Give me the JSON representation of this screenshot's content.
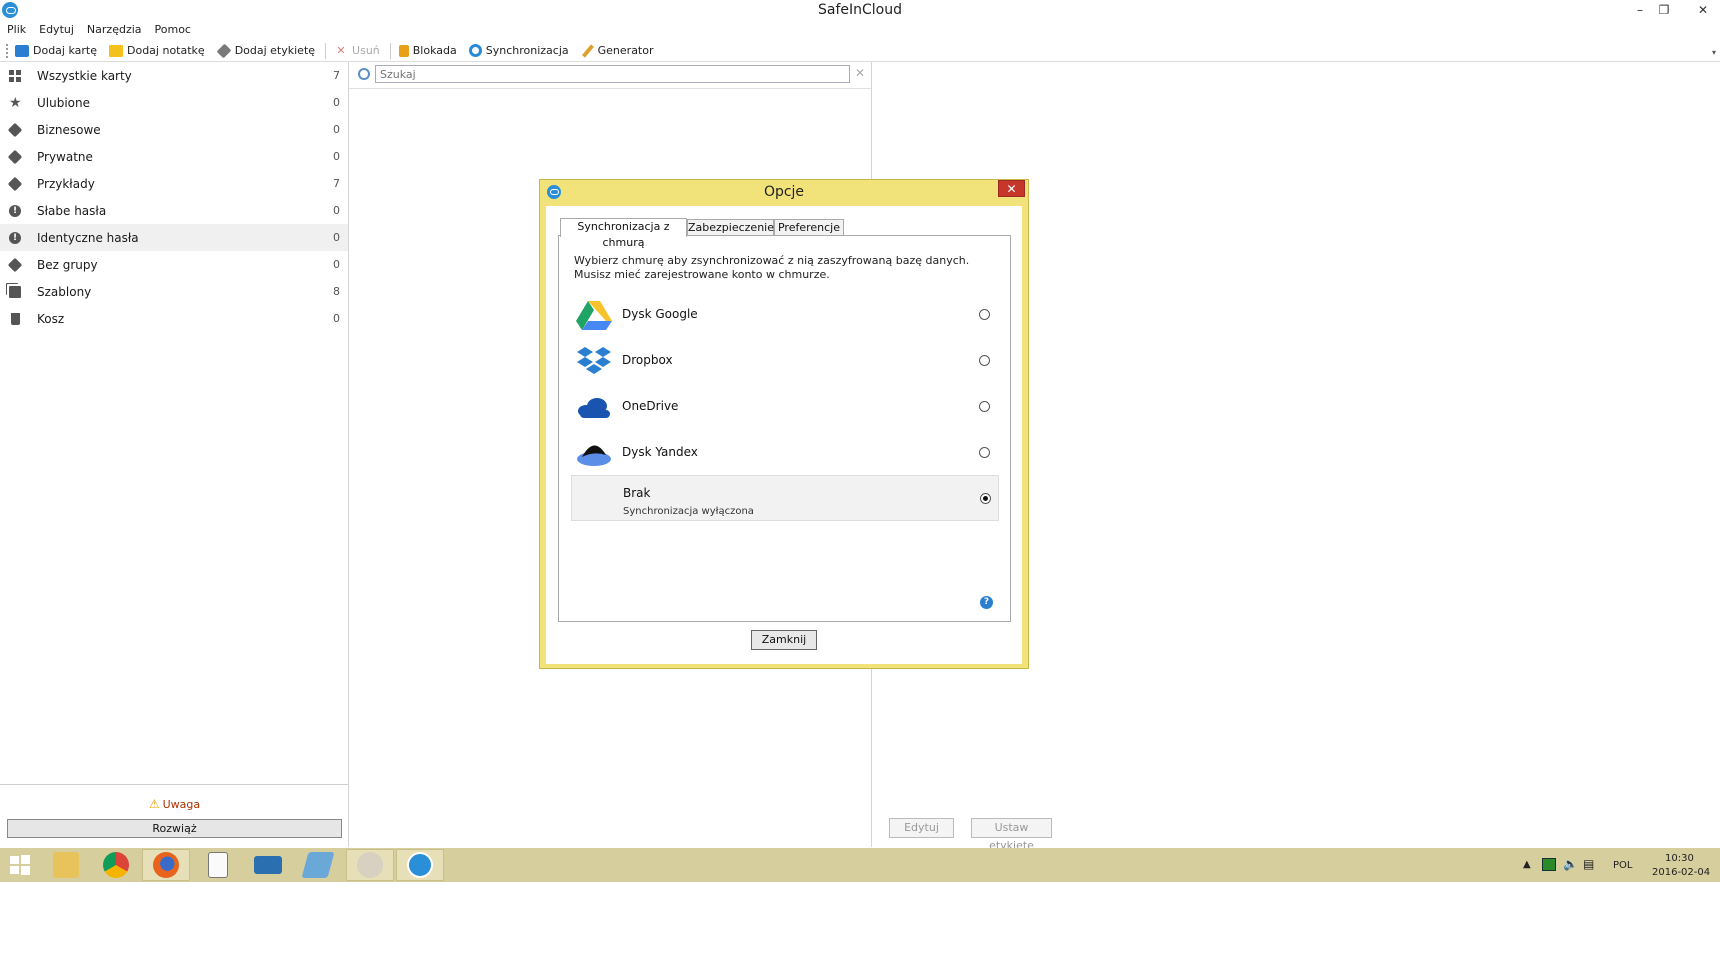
{
  "window": {
    "title": "SafeInCloud",
    "minimize": "–",
    "restore": "❐",
    "close": "✕"
  },
  "menu": [
    "Plik",
    "Edytuj",
    "Narzędzia",
    "Pomoc"
  ],
  "toolbar": {
    "add_card": "Dodaj kartę",
    "add_note": "Dodaj notatkę",
    "add_label": "Dodaj etykietę",
    "delete": "Usuń",
    "lock": "Blokada",
    "sync": "Synchronizacja",
    "generator": "Generator"
  },
  "sidebar": {
    "items": [
      {
        "label": "Wszystkie karty",
        "count": "7",
        "icon": "grid-icon"
      },
      {
        "label": "Ulubione",
        "count": "0",
        "icon": "star-icon"
      },
      {
        "label": "Biznesowe",
        "count": "0",
        "icon": "tag-icon"
      },
      {
        "label": "Prywatne",
        "count": "0",
        "icon": "tag-icon"
      },
      {
        "label": "Przykłady",
        "count": "7",
        "icon": "tag-icon"
      },
      {
        "label": "Słabe hasła",
        "count": "0",
        "icon": "warning-icon"
      },
      {
        "label": "Identyczne hasła",
        "count": "0",
        "icon": "warning-icon"
      },
      {
        "label": "Bez grupy",
        "count": "0",
        "icon": "untagged-icon"
      },
      {
        "label": "Szablony",
        "count": "8",
        "icon": "templates-icon"
      },
      {
        "label": "Kosz",
        "count": "0",
        "icon": "trash-icon"
      }
    ],
    "warning": "Uwaga",
    "solve_button": "Rozwiąż"
  },
  "search": {
    "placeholder": "Szukaj",
    "clear": "✕"
  },
  "details": {
    "edit_button": "Edytuj",
    "set_label_button": "Ustaw etykietę"
  },
  "dialog": {
    "title": "Opcje",
    "close_x": "✕",
    "tabs": [
      "Synchronizacja z chmurą",
      "Zabezpieczenie",
      "Preferencje"
    ],
    "intro": "Wybierz chmurę aby zsynchronizować z nią zaszyfrowaną bazę danych. Musisz mieć zarejestrowane konto w chmurze.",
    "clouds": [
      {
        "name": "Dysk Google",
        "sub": "",
        "checked": false
      },
      {
        "name": "Dropbox",
        "sub": "",
        "checked": false
      },
      {
        "name": "OneDrive",
        "sub": "",
        "checked": false
      },
      {
        "name": "Dysk Yandex",
        "sub": "",
        "checked": false
      },
      {
        "name": "Brak",
        "sub": "Synchronizacja wyłączona",
        "checked": true
      }
    ],
    "help": "?",
    "close_button": "Zamknij"
  },
  "taskbar": {
    "language": "POL",
    "time": "10:30",
    "date": "2016-02-04",
    "tray_arrow": "▲"
  },
  "colors": {
    "accent": "#2b8fd8",
    "dialog_frame": "#f2e27a",
    "taskbar": "#d7ce9e",
    "close_red": "#c7362b"
  }
}
